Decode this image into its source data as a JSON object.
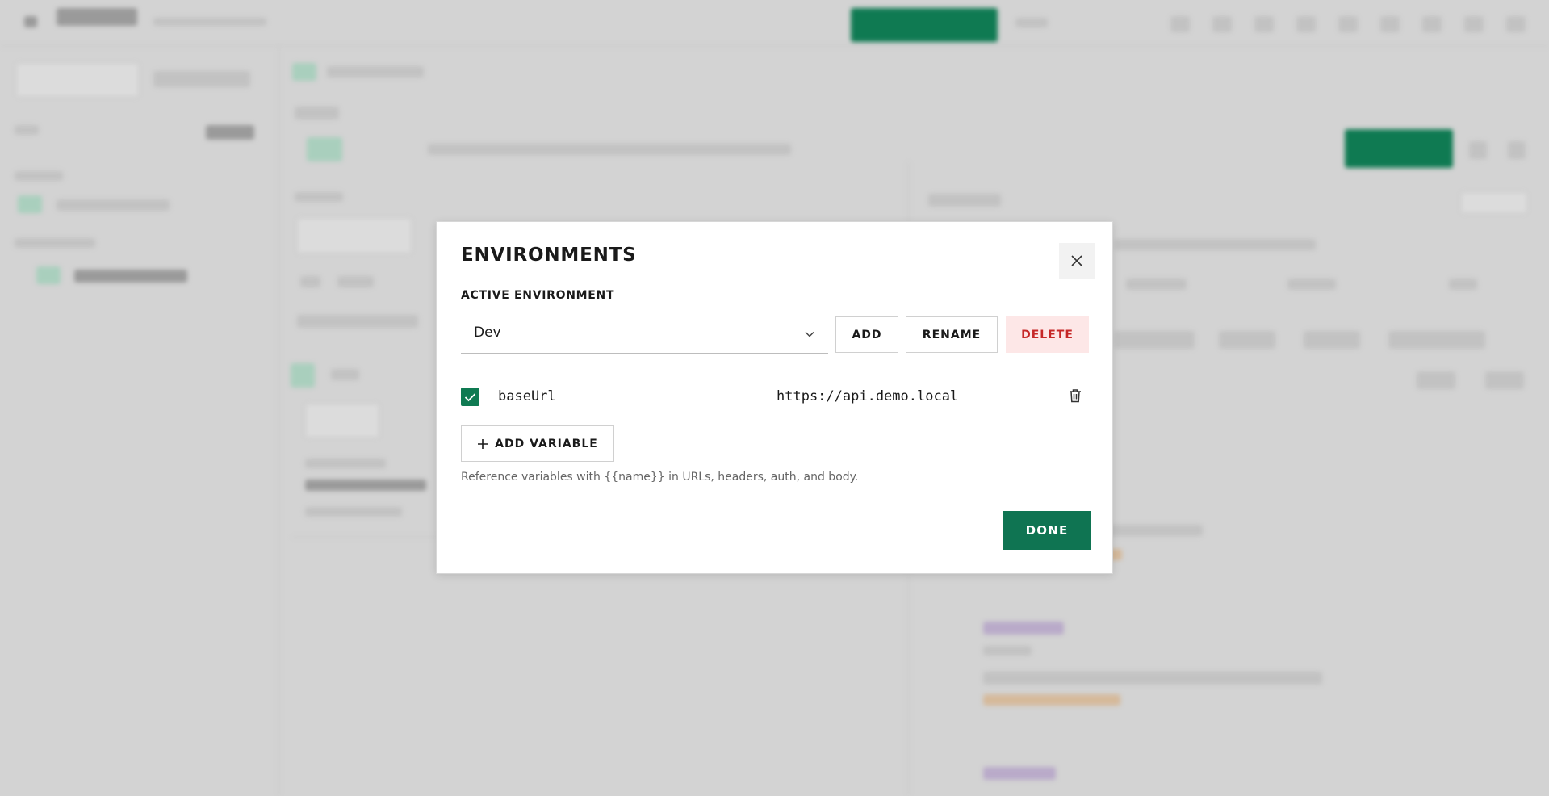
{
  "modal": {
    "title": "ENVIRONMENTS",
    "active_environment_label": "ACTIVE ENVIRONMENT",
    "selected_environment": "Dev",
    "buttons": {
      "add": "ADD",
      "rename": "RENAME",
      "delete": "DELETE",
      "add_variable": "ADD VARIABLE",
      "done": "DONE"
    },
    "variables": [
      {
        "enabled": true,
        "name": "baseUrl",
        "value": "https://api.demo.local"
      }
    ],
    "hint": "Reference variables with {{name}} in URLs, headers, auth, and body."
  },
  "colors": {
    "accent": "#0f7452",
    "danger": "#c62828",
    "danger_bg": "#fde7e7"
  },
  "icons": {
    "close": "close-icon",
    "chevron": "chevron-down-icon",
    "check": "check-icon",
    "trash": "trash-icon",
    "plus": "plus-icon"
  }
}
